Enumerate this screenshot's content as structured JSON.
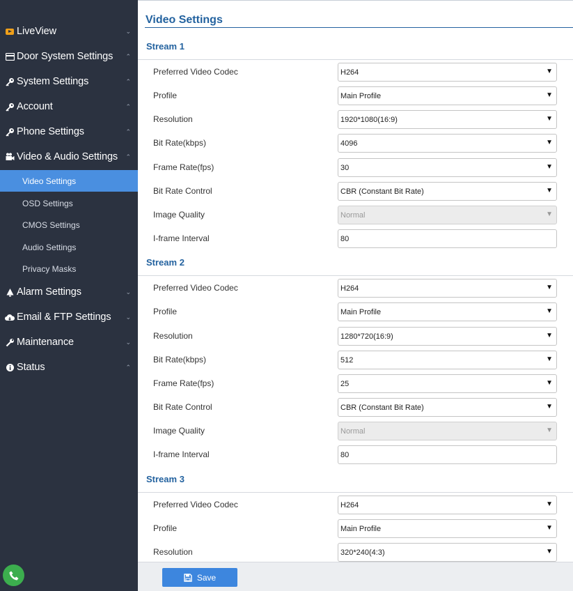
{
  "sidebar": {
    "items": [
      {
        "label": "LiveView",
        "icon": "play-icon",
        "chevron": "⌄"
      },
      {
        "label": "Door System Settings",
        "icon": "door-icon",
        "chevron": "⌃"
      },
      {
        "label": "System Settings",
        "icon": "key-icon",
        "chevron": "⌃"
      },
      {
        "label": "Account",
        "icon": "key-icon",
        "chevron": "⌃"
      },
      {
        "label": "Phone Settings",
        "icon": "key-icon",
        "chevron": "⌃"
      },
      {
        "label": "Video & Audio Settings",
        "icon": "camera-icon",
        "chevron": "⌃"
      },
      {
        "label": "Alarm Settings",
        "icon": "bell-icon",
        "chevron": "⌄"
      },
      {
        "label": "Email & FTP Settings",
        "icon": "cloud-icon",
        "chevron": "⌄"
      },
      {
        "label": "Maintenance",
        "icon": "wrench-icon",
        "chevron": "⌄"
      },
      {
        "label": "Status",
        "icon": "info-icon",
        "chevron": "⌃"
      }
    ],
    "sub_items": [
      {
        "label": "Video Settings"
      },
      {
        "label": "OSD Settings"
      },
      {
        "label": "CMOS Settings"
      },
      {
        "label": "Audio Settings"
      },
      {
        "label": "Privacy Masks"
      }
    ]
  },
  "page": {
    "title": "Video Settings"
  },
  "labels": {
    "codec": "Preferred Video Codec",
    "profile": "Profile",
    "resolution": "Resolution",
    "bitrate": "Bit Rate(kbps)",
    "framerate": "Frame Rate(fps)",
    "bitrate_control": "Bit Rate Control",
    "image_quality": "Image Quality",
    "iframe": "I-frame Interval"
  },
  "streams": [
    {
      "title": "Stream 1",
      "codec": "H264",
      "profile": "Main Profile",
      "resolution": "1920*1080(16:9)",
      "bitrate": "4096",
      "framerate": "30",
      "bitrate_control": "CBR (Constant Bit Rate)",
      "image_quality": "Normal",
      "iframe": "80"
    },
    {
      "title": "Stream 2",
      "codec": "H264",
      "profile": "Main Profile",
      "resolution": "1280*720(16:9)",
      "bitrate": "512",
      "framerate": "25",
      "bitrate_control": "CBR (Constant Bit Rate)",
      "image_quality": "Normal",
      "iframe": "80"
    },
    {
      "title": "Stream 3",
      "codec": "H264",
      "profile": "Main Profile",
      "resolution": "320*240(4:3)"
    }
  ],
  "footer": {
    "save_label": "Save"
  },
  "colors": {
    "sidebar_bg": "#2b3240",
    "active_item": "#4a8fe0",
    "accent": "#23629f",
    "save_button": "#3d86de"
  }
}
